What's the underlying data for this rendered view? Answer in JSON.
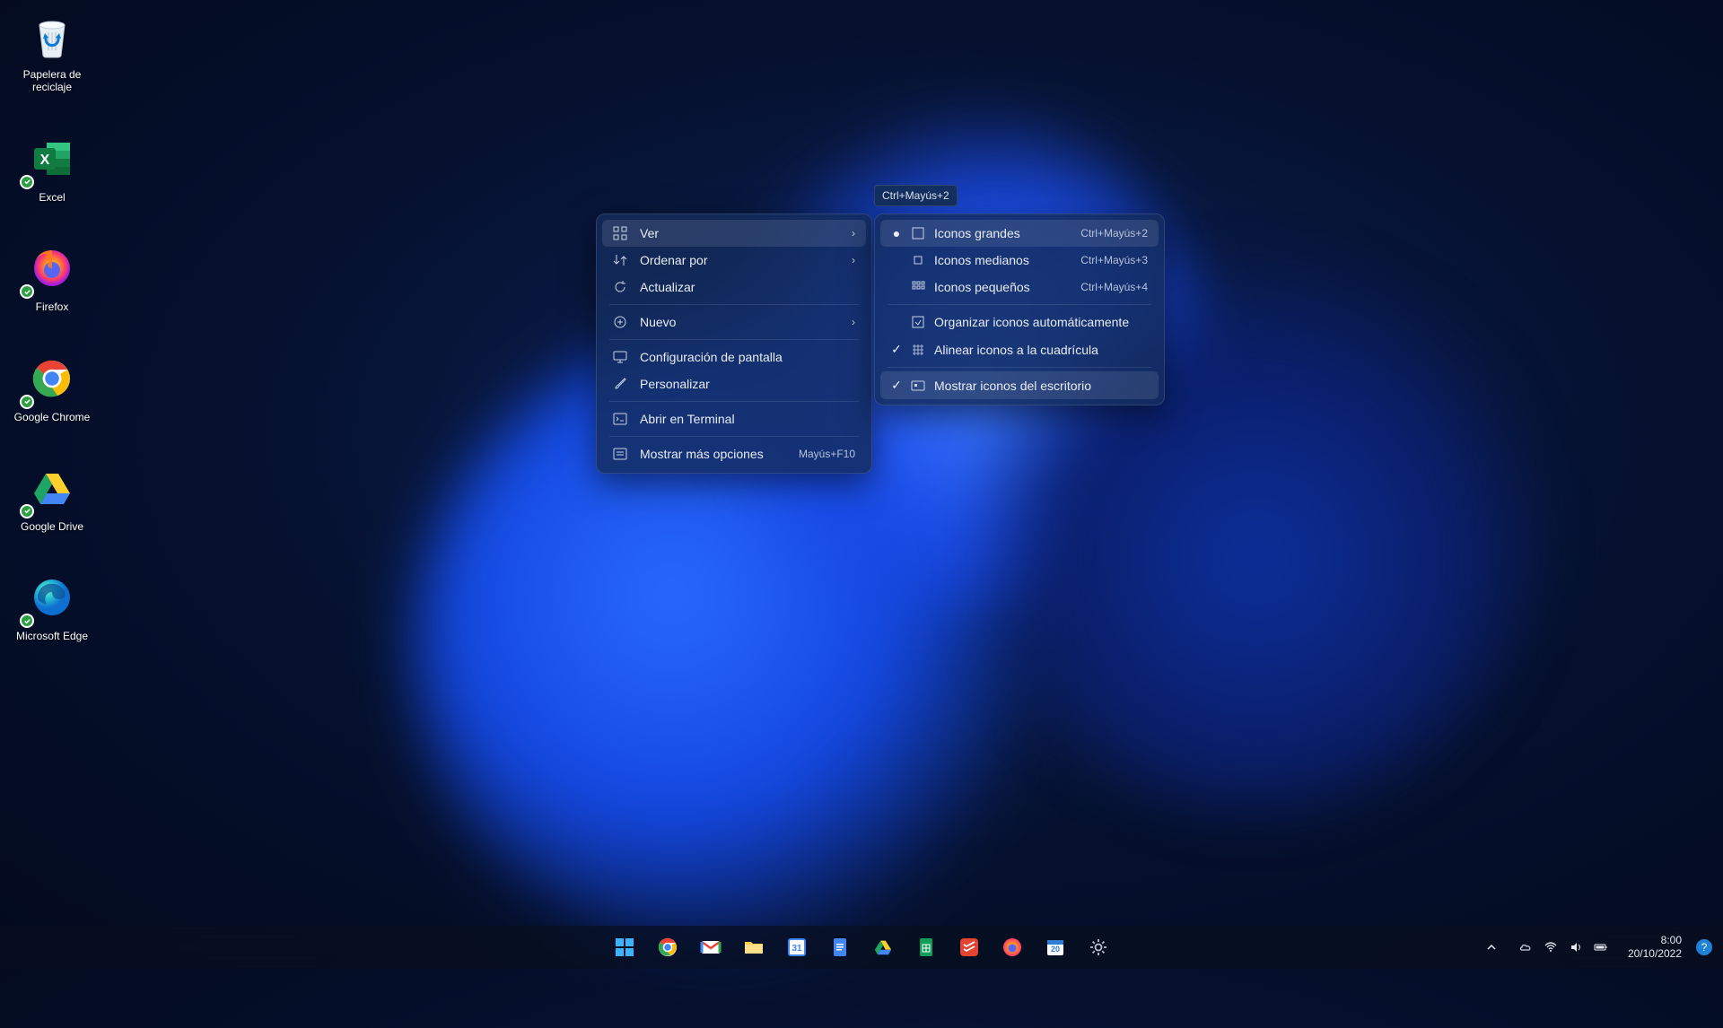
{
  "desktop": {
    "icons": [
      {
        "id": "recycle-bin",
        "label": "Papelera de reciclaje"
      },
      {
        "id": "excel",
        "label": "Excel"
      },
      {
        "id": "firefox",
        "label": "Firefox"
      },
      {
        "id": "chrome",
        "label": "Google Chrome"
      },
      {
        "id": "drive",
        "label": "Google Drive"
      },
      {
        "id": "edge",
        "label": "Microsoft Edge"
      }
    ]
  },
  "context_menu": {
    "position_hint": "desktop right-click",
    "items": [
      {
        "label": "Ver",
        "icon": "grid",
        "has_submenu": true,
        "highlighted": true
      },
      {
        "label": "Ordenar por",
        "icon": "sort",
        "has_submenu": true
      },
      {
        "label": "Actualizar",
        "icon": "refresh"
      },
      {
        "sep": true
      },
      {
        "label": "Nuevo",
        "icon": "plus",
        "has_submenu": true
      },
      {
        "sep": true
      },
      {
        "label": "Configuración de pantalla",
        "icon": "display"
      },
      {
        "label": "Personalizar",
        "icon": "brush"
      },
      {
        "sep": true
      },
      {
        "label": "Abrir en Terminal",
        "icon": "terminal"
      },
      {
        "sep": true
      },
      {
        "label": "Mostrar más opciones",
        "icon": "more",
        "shortcut": "Mayús+F10"
      }
    ]
  },
  "submenu": {
    "parent": "Ver",
    "tooltip": "Ctrl+Mayús+2",
    "items": [
      {
        "label": "Iconos grandes",
        "icon": "large",
        "shortcut": "Ctrl+Mayús+2",
        "radio": true,
        "checked": true,
        "highlighted": true
      },
      {
        "label": "Iconos medianos",
        "icon": "medium",
        "shortcut": "Ctrl+Mayús+3",
        "radio": true
      },
      {
        "label": "Iconos pequeños",
        "icon": "small",
        "shortcut": "Ctrl+Mayús+4",
        "radio": true
      },
      {
        "sep": true
      },
      {
        "label": "Organizar iconos automáticamente",
        "icon": "auto"
      },
      {
        "label": "Alinear iconos a la cuadrícula",
        "icon": "align",
        "checked": true
      },
      {
        "sep": true
      },
      {
        "label": "Mostrar iconos del escritorio",
        "icon": "show",
        "checked": true,
        "highlighted": true
      }
    ]
  },
  "taskbar": {
    "pinned": [
      {
        "id": "start",
        "name": "Inicio"
      },
      {
        "id": "chrome",
        "name": "Google Chrome"
      },
      {
        "id": "gmail",
        "name": "Gmail"
      },
      {
        "id": "explorer",
        "name": "Explorador de archivos"
      },
      {
        "id": "gcal",
        "name": "Google Calendar"
      },
      {
        "id": "gdocs",
        "name": "Google Docs"
      },
      {
        "id": "gdrive",
        "name": "Google Drive"
      },
      {
        "id": "gsheets",
        "name": "Google Sheets"
      },
      {
        "id": "todoist",
        "name": "Todoist"
      },
      {
        "id": "firefox",
        "name": "Firefox"
      },
      {
        "id": "gcal2",
        "name": "Calendar"
      },
      {
        "id": "settings",
        "name": "Configuración"
      }
    ],
    "tray": [
      {
        "id": "overflow",
        "name": "Mostrar iconos ocultos"
      },
      {
        "id": "onedrive",
        "name": "OneDrive"
      },
      {
        "id": "wifi",
        "name": "WiFi"
      },
      {
        "id": "volume",
        "name": "Volumen"
      },
      {
        "id": "battery",
        "name": "Batería"
      }
    ],
    "clock": {
      "time": "8:00",
      "date": "20/10/2022"
    },
    "help": "?"
  }
}
